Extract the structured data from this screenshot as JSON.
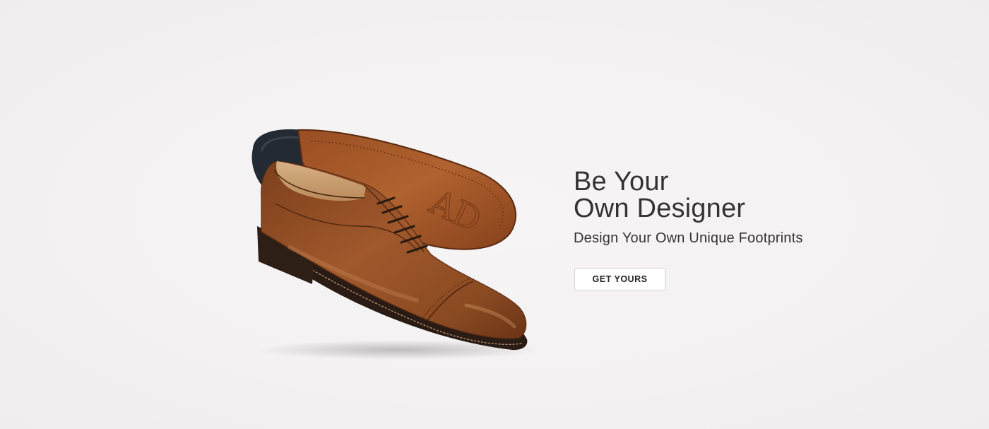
{
  "hero": {
    "headline_line1": "Be Your",
    "headline_line2": "Own Designer",
    "subheadline": "Design Your Own Unique Footprints",
    "cta_label": "GET YOURS",
    "sole_monogram": "AD"
  },
  "colors": {
    "background": "#f3f1f1",
    "text": "#333333",
    "leather": "#8a4a24",
    "button_bg": "#ffffff",
    "button_border": "#d4d4d4"
  },
  "image": {
    "subject": "product-photo-brown-oxford-shoes"
  }
}
